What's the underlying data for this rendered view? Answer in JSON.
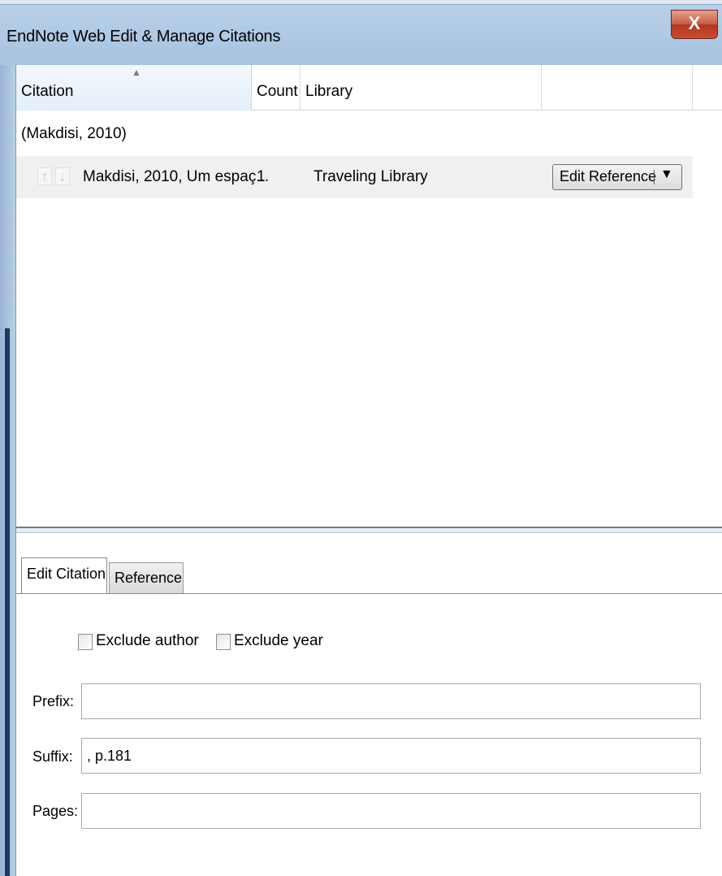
{
  "window": {
    "title": "EndNote Web Edit & Manage Citations",
    "close_label": "X"
  },
  "table": {
    "columns": {
      "citation": "Citation",
      "count": "Count",
      "library": "Library"
    },
    "group_label": "(Makdisi, 2010)",
    "row": {
      "reference": "Makdisi, 2010, Um espaç...",
      "count": "1",
      "library": "Traveling Library",
      "edit_button": "Edit Reference"
    }
  },
  "tabs": {
    "edit_citation": "Edit Citation",
    "reference": "Reference"
  },
  "form": {
    "exclude_author": {
      "label": "Exclude author",
      "checked": false
    },
    "exclude_year": {
      "label": "Exclude year",
      "checked": false
    },
    "prefix": {
      "label": "Prefix:",
      "value": ""
    },
    "suffix": {
      "label": "Suffix:",
      "value": ", p.181"
    },
    "pages": {
      "label": "Pages:",
      "value": ""
    }
  },
  "icons": {
    "move_up": "arrow-up-icon",
    "move_down": "arrow-down-icon",
    "sort": "sort-ascending-icon",
    "dropdown": "caret-down-icon"
  },
  "colors": {
    "titlebar": "#b9d1ea",
    "close_button": "#c75a43",
    "selected_row": "#f0f0f0"
  }
}
